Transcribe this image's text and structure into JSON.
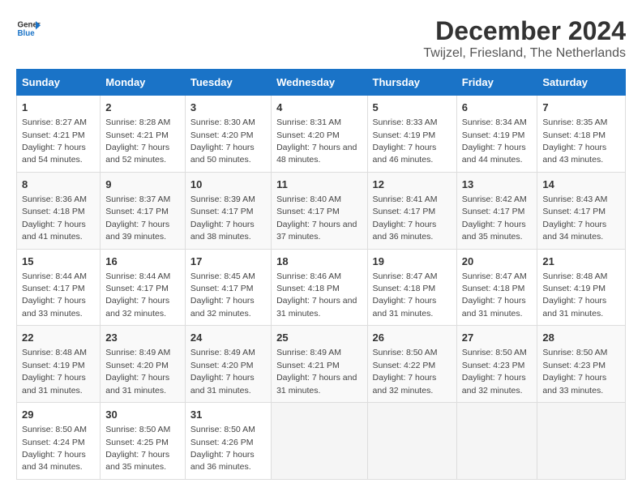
{
  "header": {
    "logo_line1": "General",
    "logo_line2": "Blue",
    "main_title": "December 2024",
    "subtitle": "Twijzel, Friesland, The Netherlands"
  },
  "days_of_week": [
    "Sunday",
    "Monday",
    "Tuesday",
    "Wednesday",
    "Thursday",
    "Friday",
    "Saturday"
  ],
  "weeks": [
    [
      {
        "day": 1,
        "sunrise": "Sunrise: 8:27 AM",
        "sunset": "Sunset: 4:21 PM",
        "daylight": "Daylight: 7 hours and 54 minutes."
      },
      {
        "day": 2,
        "sunrise": "Sunrise: 8:28 AM",
        "sunset": "Sunset: 4:21 PM",
        "daylight": "Daylight: 7 hours and 52 minutes."
      },
      {
        "day": 3,
        "sunrise": "Sunrise: 8:30 AM",
        "sunset": "Sunset: 4:20 PM",
        "daylight": "Daylight: 7 hours and 50 minutes."
      },
      {
        "day": 4,
        "sunrise": "Sunrise: 8:31 AM",
        "sunset": "Sunset: 4:20 PM",
        "daylight": "Daylight: 7 hours and 48 minutes."
      },
      {
        "day": 5,
        "sunrise": "Sunrise: 8:33 AM",
        "sunset": "Sunset: 4:19 PM",
        "daylight": "Daylight: 7 hours and 46 minutes."
      },
      {
        "day": 6,
        "sunrise": "Sunrise: 8:34 AM",
        "sunset": "Sunset: 4:19 PM",
        "daylight": "Daylight: 7 hours and 44 minutes."
      },
      {
        "day": 7,
        "sunrise": "Sunrise: 8:35 AM",
        "sunset": "Sunset: 4:18 PM",
        "daylight": "Daylight: 7 hours and 43 minutes."
      }
    ],
    [
      {
        "day": 8,
        "sunrise": "Sunrise: 8:36 AM",
        "sunset": "Sunset: 4:18 PM",
        "daylight": "Daylight: 7 hours and 41 minutes."
      },
      {
        "day": 9,
        "sunrise": "Sunrise: 8:37 AM",
        "sunset": "Sunset: 4:17 PM",
        "daylight": "Daylight: 7 hours and 39 minutes."
      },
      {
        "day": 10,
        "sunrise": "Sunrise: 8:39 AM",
        "sunset": "Sunset: 4:17 PM",
        "daylight": "Daylight: 7 hours and 38 minutes."
      },
      {
        "day": 11,
        "sunrise": "Sunrise: 8:40 AM",
        "sunset": "Sunset: 4:17 PM",
        "daylight": "Daylight: 7 hours and 37 minutes."
      },
      {
        "day": 12,
        "sunrise": "Sunrise: 8:41 AM",
        "sunset": "Sunset: 4:17 PM",
        "daylight": "Daylight: 7 hours and 36 minutes."
      },
      {
        "day": 13,
        "sunrise": "Sunrise: 8:42 AM",
        "sunset": "Sunset: 4:17 PM",
        "daylight": "Daylight: 7 hours and 35 minutes."
      },
      {
        "day": 14,
        "sunrise": "Sunrise: 8:43 AM",
        "sunset": "Sunset: 4:17 PM",
        "daylight": "Daylight: 7 hours and 34 minutes."
      }
    ],
    [
      {
        "day": 15,
        "sunrise": "Sunrise: 8:44 AM",
        "sunset": "Sunset: 4:17 PM",
        "daylight": "Daylight: 7 hours and 33 minutes."
      },
      {
        "day": 16,
        "sunrise": "Sunrise: 8:44 AM",
        "sunset": "Sunset: 4:17 PM",
        "daylight": "Daylight: 7 hours and 32 minutes."
      },
      {
        "day": 17,
        "sunrise": "Sunrise: 8:45 AM",
        "sunset": "Sunset: 4:17 PM",
        "daylight": "Daylight: 7 hours and 32 minutes."
      },
      {
        "day": 18,
        "sunrise": "Sunrise: 8:46 AM",
        "sunset": "Sunset: 4:18 PM",
        "daylight": "Daylight: 7 hours and 31 minutes."
      },
      {
        "day": 19,
        "sunrise": "Sunrise: 8:47 AM",
        "sunset": "Sunset: 4:18 PM",
        "daylight": "Daylight: 7 hours and 31 minutes."
      },
      {
        "day": 20,
        "sunrise": "Sunrise: 8:47 AM",
        "sunset": "Sunset: 4:18 PM",
        "daylight": "Daylight: 7 hours and 31 minutes."
      },
      {
        "day": 21,
        "sunrise": "Sunrise: 8:48 AM",
        "sunset": "Sunset: 4:19 PM",
        "daylight": "Daylight: 7 hours and 31 minutes."
      }
    ],
    [
      {
        "day": 22,
        "sunrise": "Sunrise: 8:48 AM",
        "sunset": "Sunset: 4:19 PM",
        "daylight": "Daylight: 7 hours and 31 minutes."
      },
      {
        "day": 23,
        "sunrise": "Sunrise: 8:49 AM",
        "sunset": "Sunset: 4:20 PM",
        "daylight": "Daylight: 7 hours and 31 minutes."
      },
      {
        "day": 24,
        "sunrise": "Sunrise: 8:49 AM",
        "sunset": "Sunset: 4:20 PM",
        "daylight": "Daylight: 7 hours and 31 minutes."
      },
      {
        "day": 25,
        "sunrise": "Sunrise: 8:49 AM",
        "sunset": "Sunset: 4:21 PM",
        "daylight": "Daylight: 7 hours and 31 minutes."
      },
      {
        "day": 26,
        "sunrise": "Sunrise: 8:50 AM",
        "sunset": "Sunset: 4:22 PM",
        "daylight": "Daylight: 7 hours and 32 minutes."
      },
      {
        "day": 27,
        "sunrise": "Sunrise: 8:50 AM",
        "sunset": "Sunset: 4:23 PM",
        "daylight": "Daylight: 7 hours and 32 minutes."
      },
      {
        "day": 28,
        "sunrise": "Sunrise: 8:50 AM",
        "sunset": "Sunset: 4:23 PM",
        "daylight": "Daylight: 7 hours and 33 minutes."
      }
    ],
    [
      {
        "day": 29,
        "sunrise": "Sunrise: 8:50 AM",
        "sunset": "Sunset: 4:24 PM",
        "daylight": "Daylight: 7 hours and 34 minutes."
      },
      {
        "day": 30,
        "sunrise": "Sunrise: 8:50 AM",
        "sunset": "Sunset: 4:25 PM",
        "daylight": "Daylight: 7 hours and 35 minutes."
      },
      {
        "day": 31,
        "sunrise": "Sunrise: 8:50 AM",
        "sunset": "Sunset: 4:26 PM",
        "daylight": "Daylight: 7 hours and 36 minutes."
      },
      null,
      null,
      null,
      null
    ]
  ]
}
